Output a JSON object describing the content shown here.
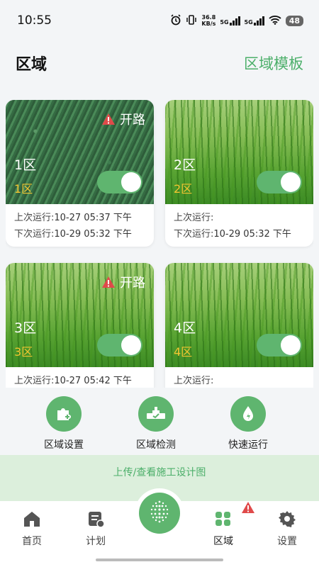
{
  "status_bar": {
    "time": "10:55",
    "net_speed_value": "36.8",
    "net_speed_unit": "KB/s",
    "signal1_label": "5G",
    "signal2_label": "5G",
    "battery": "48"
  },
  "header": {
    "title": "区域",
    "template_link": "区域模板"
  },
  "zones": [
    {
      "name": "1区",
      "sub_label": "1区",
      "alert_text": "开路",
      "has_alert": true,
      "image_style": "dark",
      "enabled": true,
      "last_run_label": "上次运行:",
      "last_run_value": "10-27 05:37 下午",
      "next_run_label": "下次运行:",
      "next_run_value": "10-29 05:32 下午"
    },
    {
      "name": "2区",
      "sub_label": "2区",
      "alert_text": "",
      "has_alert": false,
      "image_style": "light",
      "enabled": true,
      "last_run_label": "上次运行:",
      "last_run_value": "",
      "next_run_label": "下次运行:",
      "next_run_value": "10-29 05:32 下午"
    },
    {
      "name": "3区",
      "sub_label": "3区",
      "alert_text": "开路",
      "has_alert": true,
      "image_style": "light",
      "enabled": true,
      "last_run_label": "上次运行:",
      "last_run_value": "10-27 05:42 下午",
      "next_run_label": "",
      "next_run_value": ""
    },
    {
      "name": "4区",
      "sub_label": "4区",
      "alert_text": "",
      "has_alert": false,
      "image_style": "light",
      "enabled": true,
      "last_run_label": "上次运行:",
      "last_run_value": "",
      "next_run_label": "",
      "next_run_value": ""
    }
  ],
  "actions": {
    "zone_settings": "区域设置",
    "zone_detect": "区域检测",
    "quick_run": "快速运行"
  },
  "banner": {
    "text": "上传/查看施工设计图"
  },
  "tabbar": {
    "home": "首页",
    "plan": "计划",
    "zone": "区域",
    "settings": "设置"
  },
  "colors": {
    "accent": "#5fb56f",
    "alert": "#e04a4a",
    "sub_label": "#f2c531"
  }
}
